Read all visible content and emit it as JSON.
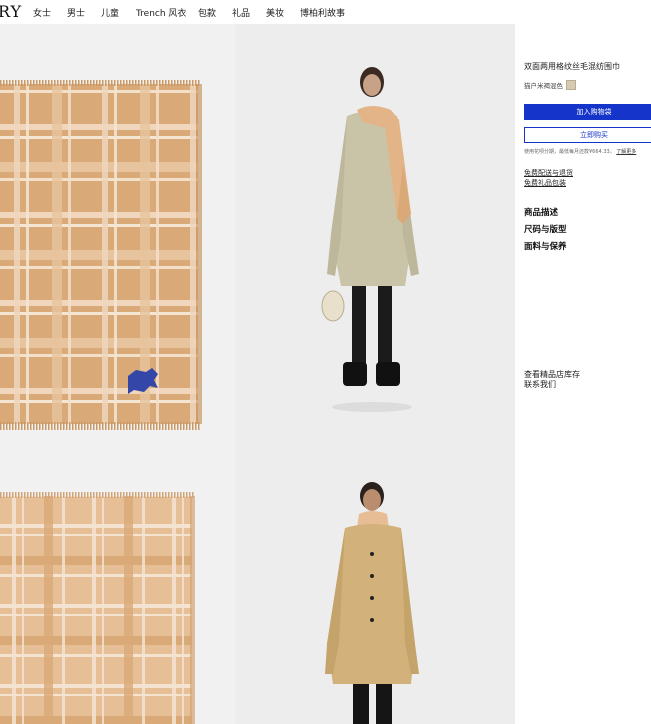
{
  "brand": {
    "logo_partial": "RY"
  },
  "nav": {
    "items": [
      {
        "label": "女士"
      },
      {
        "label": "男士"
      },
      {
        "label": "儿童"
      },
      {
        "label": "Trench 风衣"
      },
      {
        "label": "包款"
      },
      {
        "label": "礼品"
      },
      {
        "label": "美妆"
      },
      {
        "label": "博柏利故事"
      }
    ]
  },
  "product": {
    "title": "双面两用格纹丝毛混纺围巾",
    "color_label": "猫户米褐混色",
    "color_swatch": "#d6cbb1",
    "add_to_cart": "加入购物袋",
    "buy_now": "立即购买",
    "installment_text": "使用花呗分期，最低每月还款¥664.33。",
    "installment_link": "了解更多",
    "delivery_link": "免费配送与退货",
    "gift_link": "免费礼品包装",
    "sections": [
      "商品描述",
      "尺码与版型",
      "面料与保养"
    ],
    "store_link": "查看精品店库存",
    "contact_link": "联系我们"
  },
  "colors": {
    "accent": "#1534c9",
    "check_base": "#d9a977",
    "check_light": "#efd6bc"
  },
  "icons": {
    "logo_emblem": "equestrian-knight-icon"
  }
}
